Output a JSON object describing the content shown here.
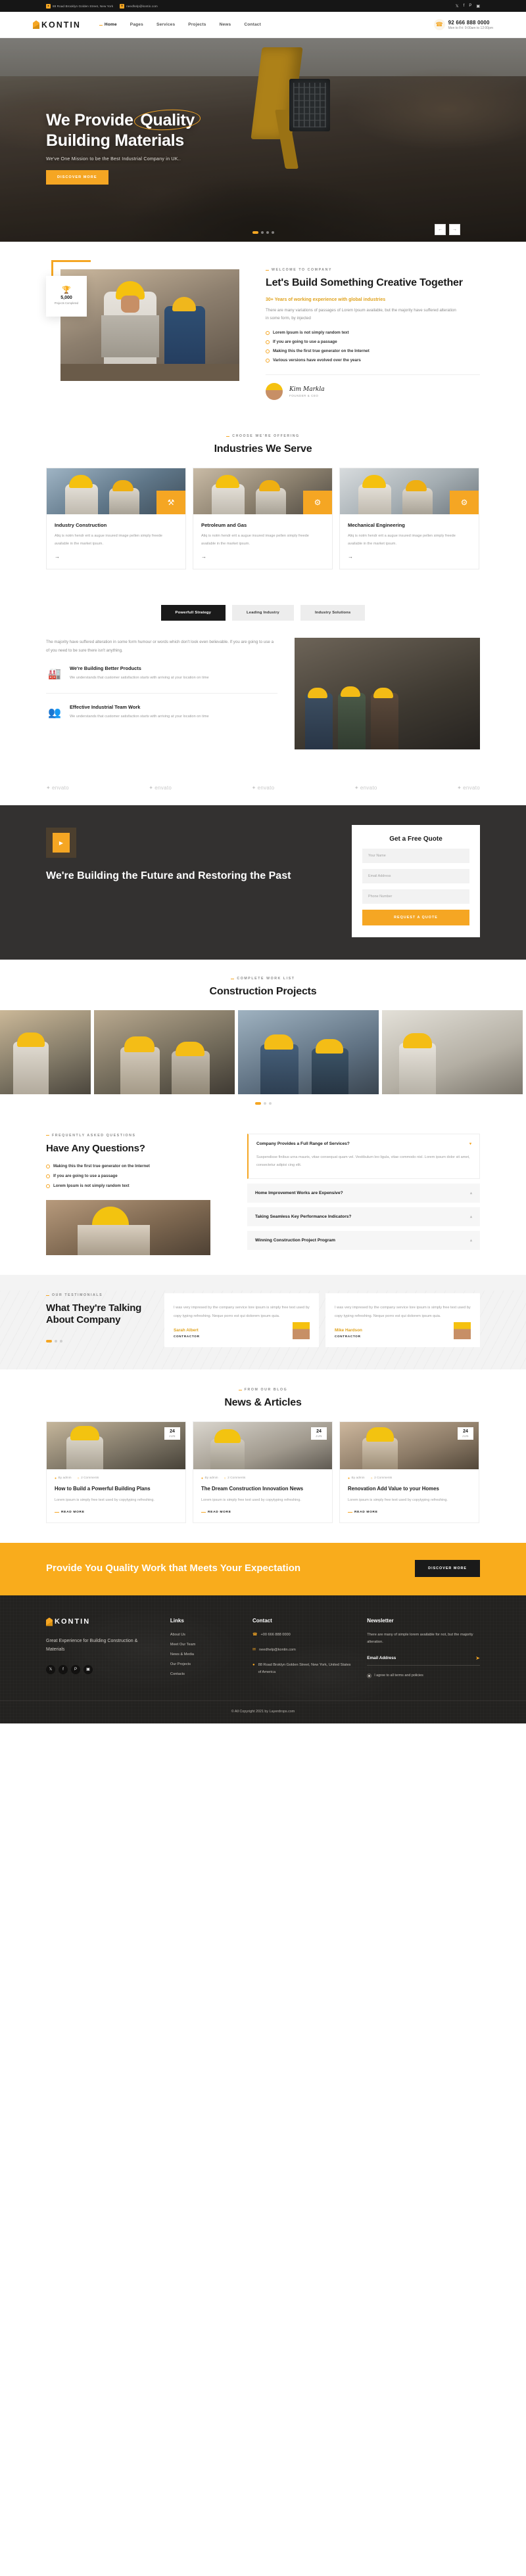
{
  "topbar": {
    "address": "88 Road Brooklyn Golden Street, New York",
    "email": "needhelp@kontin.com",
    "address_icon": "location-pin-icon",
    "email_icon": "envelope-icon",
    "socials": [
      "twitter",
      "facebook",
      "pinterest",
      "instagram"
    ],
    "social_glyphs": [
      "𝕏",
      "f",
      "P",
      "▣"
    ],
    "bg": "#161616"
  },
  "header": {
    "brand": "KONTIN",
    "nav": [
      {
        "label": "Home",
        "active": true
      },
      {
        "label": "Pages",
        "active": false
      },
      {
        "label": "Services",
        "active": false
      },
      {
        "label": "Projects",
        "active": false
      },
      {
        "label": "News",
        "active": false
      },
      {
        "label": "Contact",
        "active": false
      }
    ],
    "phone": "92 666 888 0000",
    "hours": "Mon to Fri: 9:00am to 12:00pm",
    "phone_icon": "phone-icon"
  },
  "hero": {
    "title_1": "We Provide ",
    "title_circled": "Quality",
    "title_2": "Building Materials",
    "subtitle": "We've One Mission to be the Best Industrial Company in UK..",
    "cta": "DISCOVER MORE",
    "slide_count": 4,
    "active_slide": 1,
    "prev_icon": "chevron-left-icon",
    "next_icon": "chevron-right-icon"
  },
  "about": {
    "label": "WELCOME TO COMPANY",
    "title": "Let's Build Something Creative Together",
    "lead": "30+ Years of working experience with global industries",
    "paragraph": "There are many variations of passages of Lorem Ipsum available, but the majority have suffered alteration in some form, by injected",
    "bullets": [
      "Lorem Ipsum is not simply random text",
      "If you are going to use a passage",
      "Making this the first true generator on the Internet",
      "Various versions have evolved over the years"
    ],
    "badge_number": "5,000",
    "badge_text": "Projects Completed",
    "badge_icon": "trophy-icon",
    "signature": "Kim Markla",
    "signature_role": "FOUNDER & CEO"
  },
  "industries": {
    "label": "CHOOSE WE'RE OFFERING",
    "title": "Industries We Serve",
    "cards": [
      {
        "title": "Industry Construction",
        "desc": "Aliq is notm hendr erit a augue insured image pellen simply freede available in the market ipsum.",
        "icon": "crane-icon"
      },
      {
        "title": "Petroleum and Gas",
        "desc": "Aliq is notm hendr erit a augue insured image pellen simply freede available in the market ipsum.",
        "icon": "oil-barrel-icon"
      },
      {
        "title": "Mechanical Engineering",
        "desc": "Aliq is notm hendr erit a augue insured image pellen simply freede available in the market ipsum.",
        "icon": "gear-icon"
      }
    ],
    "arrow_icon": "arrow-right-icon"
  },
  "tabs": {
    "items": [
      {
        "label": "Powerfull Strategy",
        "active": true
      },
      {
        "label": "Leading Industry",
        "active": false
      },
      {
        "label": "Industry Solutions",
        "active": false
      }
    ],
    "paragraph": "The majority have suffered alteration in some form humour or words which don't look even believable. If you are going to use a of you need to be sure there isn't anything.",
    "features": [
      {
        "title": "We're Building Better Products",
        "desc": "We understands that customer satisfaction starts with arriving at your location on time",
        "icon": "factory-icon"
      },
      {
        "title": "Effective Industrial Team Work",
        "desc": "We understands that customer satisfaction starts with arriving at your location on time",
        "icon": "team-icon"
      }
    ]
  },
  "brands": {
    "items": [
      "envato",
      "envato",
      "envato",
      "envato",
      "envato"
    ],
    "icon": "leaf-icon"
  },
  "dark_cta": {
    "title": "We're Building the Future and Restoring the Past",
    "play_icon": "play-icon",
    "form": {
      "title": "Get a Free Quote",
      "fields": [
        {
          "placeholder": "Your Name",
          "value": ""
        },
        {
          "placeholder": "Email Address",
          "value": ""
        },
        {
          "placeholder": "Phone Number",
          "value": ""
        }
      ],
      "submit": "REQUEST A QUOTE"
    }
  },
  "projects": {
    "label": "COMPLETE WORK LIST",
    "title": "Construction Projects",
    "slide_count": 3,
    "active_slide": 1
  },
  "faq": {
    "label": "FREQUENTLY ASKED QUESTIONS",
    "title": "Have Any Questions?",
    "bullets": [
      "Making this the first true generator on the Internet",
      "If you are going to use a passage",
      "Lorem Ipsum is not simply random text"
    ],
    "items": [
      {
        "q": "Company Provides a Full Range of Services?",
        "a": "Suspendisse finibus urna mauris, vitae consequat quam vel. Vestibulum leo ligula, vitae commodo nisl. Lorem ipsum dolor sit amet, consectetur adipisi cing elit.",
        "open": true
      },
      {
        "q": "Home Improvement Works are Expensive?",
        "a": "",
        "open": false
      },
      {
        "q": "Taking Seamless Key Performance Indicators?",
        "a": "",
        "open": false
      },
      {
        "q": "Winning Construction Project Program",
        "a": "",
        "open": false
      }
    ],
    "chev_open": "▾",
    "chev_closed": "▴"
  },
  "testimonials": {
    "label": "OUR TESTIMONIALS",
    "title": "What They're Talking About Company",
    "slide_count": 3,
    "active_slide": 1,
    "cards": [
      {
        "text": "I was very impresed by the company service lore ipsum is simply free text used by copy typing refreshing. Neque porro est qui dolorem ipsum quia.",
        "name": "Sarah Albert",
        "role": "CONTRACTOR"
      },
      {
        "text": "I was very impresed by the company service lore ipsum is simply free text used by copy typing refreshing. Neque porro est qui dolorem ipsum quia.",
        "name": "Mike Hardson",
        "role": "CONTRACTOR"
      }
    ]
  },
  "news": {
    "label": "FROM OUR BLOG",
    "title": "News & Articles",
    "items": [
      {
        "day": "24",
        "month": "JUN",
        "author": "By admin",
        "comments": "2 Comments",
        "title": "How to Build a Powerful Building Plans",
        "excerpt": "Lorem ipsum is simply free text used by copytyping refreshing.",
        "more": "READ MORE"
      },
      {
        "day": "24",
        "month": "JUN",
        "author": "By admin",
        "comments": "2 Comments",
        "title": "The Dream Construction Innovation News",
        "excerpt": "Lorem ipsum is simply free text used by copytyping refreshing.",
        "more": "READ MORE"
      },
      {
        "day": "24",
        "month": "JUN",
        "author": "By admin",
        "comments": "2 Comments",
        "title": "Renovation Add Value to your Homes",
        "excerpt": "Lorem ipsum is simply free text used by copytyping refreshing.",
        "more": "READ MORE"
      }
    ],
    "author_icon": "user-icon",
    "comment_icon": "comment-icon"
  },
  "yellow_cta": {
    "title": "Provide You Quality Work that Meets Your Expectation",
    "button": "DISCOVER MORE"
  },
  "footer": {
    "brand": "KONTIN",
    "tagline": "Great Experience for Building Construction & Materials",
    "socials": [
      "twitter",
      "facebook",
      "pinterest",
      "instagram"
    ],
    "social_glyphs": [
      "𝕏",
      "f",
      "P",
      "▣"
    ],
    "links_title": "Links",
    "links": [
      "About Us",
      "Meet Our Team",
      "News & Media",
      "Our Projects",
      "Contacts"
    ],
    "contact_title": "Contact",
    "contact_phone": "+00 666 888 0000",
    "contact_email": "needhelp@kontin.com",
    "contact_address": "88 Road Broklyn Golden Street, New York, United States of America",
    "newsletter_title": "Newsletter",
    "newsletter_text": "There are many of simple lorem available for not, but the majority alteration.",
    "newsletter_placeholder": "Email Address",
    "newsletter_agree": "I agree to all terms and policies",
    "send_icon": "send-icon",
    "copyright": "© All Copyright 2021 by Layerdrops.com"
  },
  "colors": {
    "accent": "#f5a623",
    "dark": "#1a1a1a",
    "footer_bg": "#232220"
  }
}
